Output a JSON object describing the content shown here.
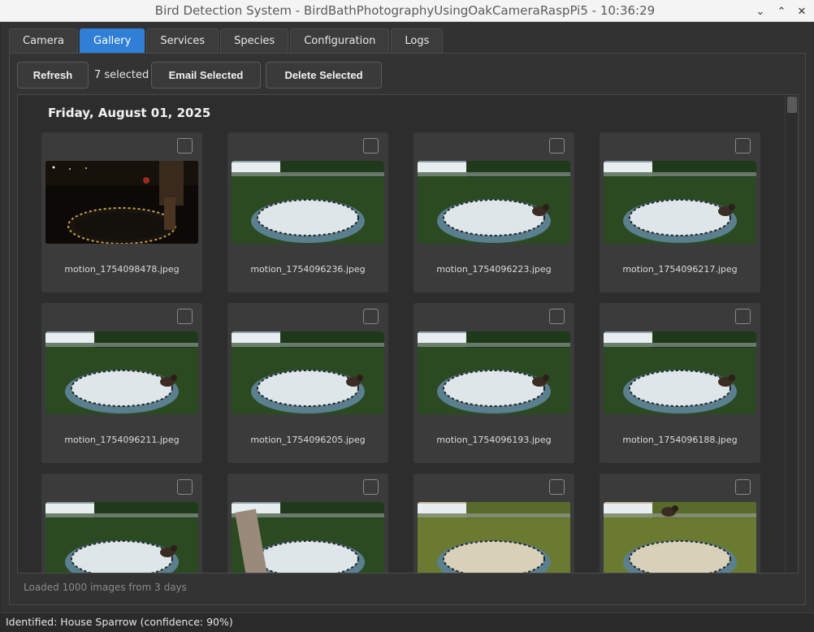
{
  "window": {
    "title": "Bird Detection System - BirdBathPhotographyUsingOakCameraRaspPi5 - 10:36:29"
  },
  "tabs": [
    {
      "label": "Camera",
      "active": false
    },
    {
      "label": "Gallery",
      "active": true
    },
    {
      "label": "Services",
      "active": false
    },
    {
      "label": "Species",
      "active": false
    },
    {
      "label": "Configuration",
      "active": false
    },
    {
      "label": "Logs",
      "active": false
    }
  ],
  "toolbar": {
    "refresh_label": "Refresh",
    "selected_count": "7 selected",
    "email_label": "Email Selected",
    "delete_label": "Delete Selected"
  },
  "gallery": {
    "date_header": "Friday, August 01, 2025",
    "images": [
      {
        "filename": "motion_1754098478.jpeg",
        "scene": "night",
        "checked": false
      },
      {
        "filename": "motion_1754096236.jpeg",
        "scene": "day",
        "checked": false
      },
      {
        "filename": "motion_1754096223.jpeg",
        "scene": "day-bird",
        "checked": false
      },
      {
        "filename": "motion_1754096217.jpeg",
        "scene": "day-bird",
        "checked": false
      },
      {
        "filename": "motion_1754096211.jpeg",
        "scene": "day-bird",
        "checked": false
      },
      {
        "filename": "motion_1754096205.jpeg",
        "scene": "day-bird",
        "checked": false
      },
      {
        "filename": "motion_1754096193.jpeg",
        "scene": "day-bird",
        "checked": false
      },
      {
        "filename": "motion_1754096188.jpeg",
        "scene": "day-bird",
        "checked": false
      },
      {
        "filename": "",
        "scene": "day-bird",
        "checked": false
      },
      {
        "filename": "",
        "scene": "day-arm",
        "checked": false
      },
      {
        "filename": "",
        "scene": "sunlit",
        "checked": false
      },
      {
        "filename": "",
        "scene": "sunlit-bird",
        "checked": false
      }
    ],
    "loaded_status": "Loaded 1000 images from 3 days"
  },
  "statusbar": {
    "text": "Identified: House Sparrow (confidence: 90%)"
  },
  "colors": {
    "accent": "#2f7fd6",
    "background": "#323232",
    "card": "#3b3b3b"
  }
}
